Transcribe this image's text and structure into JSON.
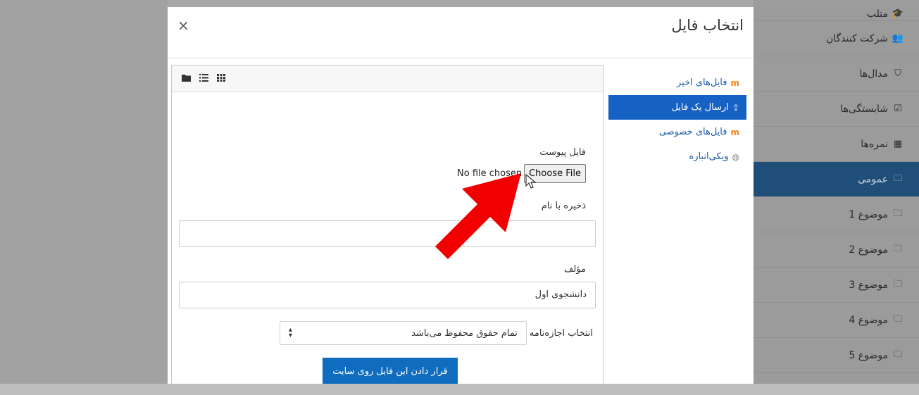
{
  "sidebar": {
    "items": [
      {
        "icon": "graduation-cap-icon",
        "glyph": "🎓",
        "label": "متلب",
        "active": false
      },
      {
        "icon": "users-icon",
        "glyph": "👥",
        "label": "شرکت کنندگان",
        "active": false
      },
      {
        "icon": "shield-icon",
        "glyph": "⛉",
        "label": "مدال‌ها",
        "active": false
      },
      {
        "icon": "check-square-icon",
        "glyph": "☑",
        "label": "شایستگی‌ها",
        "active": false
      },
      {
        "icon": "table-icon",
        "glyph": "▦",
        "label": "نمره‌ها",
        "active": false
      },
      {
        "icon": "folder-icon",
        "glyph": "🗀",
        "label": "عمومی",
        "active": true
      },
      {
        "icon": "folder-icon",
        "glyph": "🗀",
        "label": "موضوع 1",
        "active": false
      },
      {
        "icon": "folder-icon",
        "glyph": "🗀",
        "label": "موضوع 2",
        "active": false
      },
      {
        "icon": "folder-icon",
        "glyph": "🗀",
        "label": "موضوع 3",
        "active": false
      },
      {
        "icon": "folder-icon",
        "glyph": "🗀",
        "label": "موضوع 4",
        "active": false
      },
      {
        "icon": "folder-icon",
        "glyph": "🗀",
        "label": "موضوع 5",
        "active": false
      }
    ]
  },
  "modal": {
    "title": "انتخاب فایل",
    "close": "×"
  },
  "repos": [
    {
      "label": "فایل‌های اخیر",
      "icon": "moodle-icon",
      "glyph": "m",
      "active": false
    },
    {
      "label": "ارسال یک فایل",
      "icon": "upload-icon",
      "glyph": "⇪",
      "active": true
    },
    {
      "label": "فایل‌های خصوصی",
      "icon": "moodle-icon",
      "glyph": "m",
      "active": false
    },
    {
      "label": "ویکی‌انباره",
      "icon": "wikimedia-icon",
      "glyph": "◍",
      "active": false
    }
  ],
  "viewbar": {
    "icons": [
      "folder-view-icon",
      "list-view-icon",
      "grid-view-icon"
    ]
  },
  "form": {
    "attachment_label": "فایل پیوست",
    "choose_button": "Choose File",
    "no_file": "No file chosen",
    "save_as_label": "ذخیره با نام",
    "save_as_value": "",
    "author_label": "مؤلف",
    "author_value": "دانشجوی اول",
    "license_label": "انتخاب اجازه‌نامه",
    "license_value": "تمام حقوق محفوظ می‌باشد",
    "upload_button": "قرار دادن این فایل روی سایت"
  },
  "colors": {
    "accent": "#1662c4",
    "upload_button": "#0f6cbf",
    "arrow": "#f20000"
  }
}
